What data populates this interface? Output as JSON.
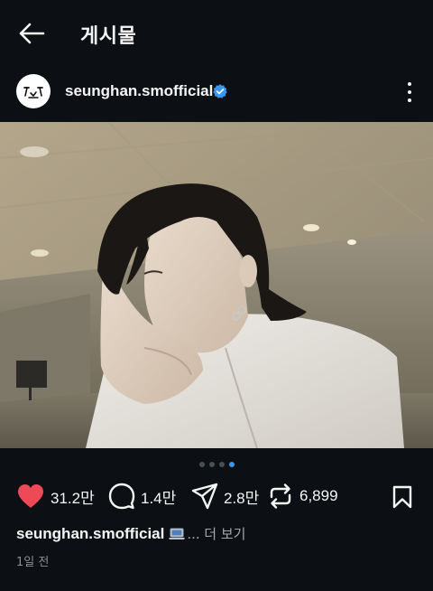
{
  "header": {
    "title": "게시물"
  },
  "post": {
    "username": "seunghan.smofficial",
    "verified": true,
    "carousel": {
      "total": 4,
      "current": 4
    },
    "stats": {
      "likes": "31.2만",
      "comments": "1.4만",
      "shares": "2.8만",
      "reposts": "6,899"
    },
    "caption": {
      "username": "seunghan.smofficial",
      "ellipsis": "...",
      "more_label": "더 보기"
    },
    "timestamp": "1일 전"
  },
  "colors": {
    "background": "#0c1014",
    "like_red": "#ed4956",
    "verified_blue": "#3897f0",
    "muted": "#a8a8a8"
  },
  "icons": {
    "back": "back-arrow-icon",
    "verified": "verified-badge-icon",
    "more": "more-options-icon",
    "like": "heart-filled-icon",
    "comment": "comment-icon",
    "share": "paper-plane-icon",
    "repost": "repost-icon",
    "save": "bookmark-icon"
  }
}
